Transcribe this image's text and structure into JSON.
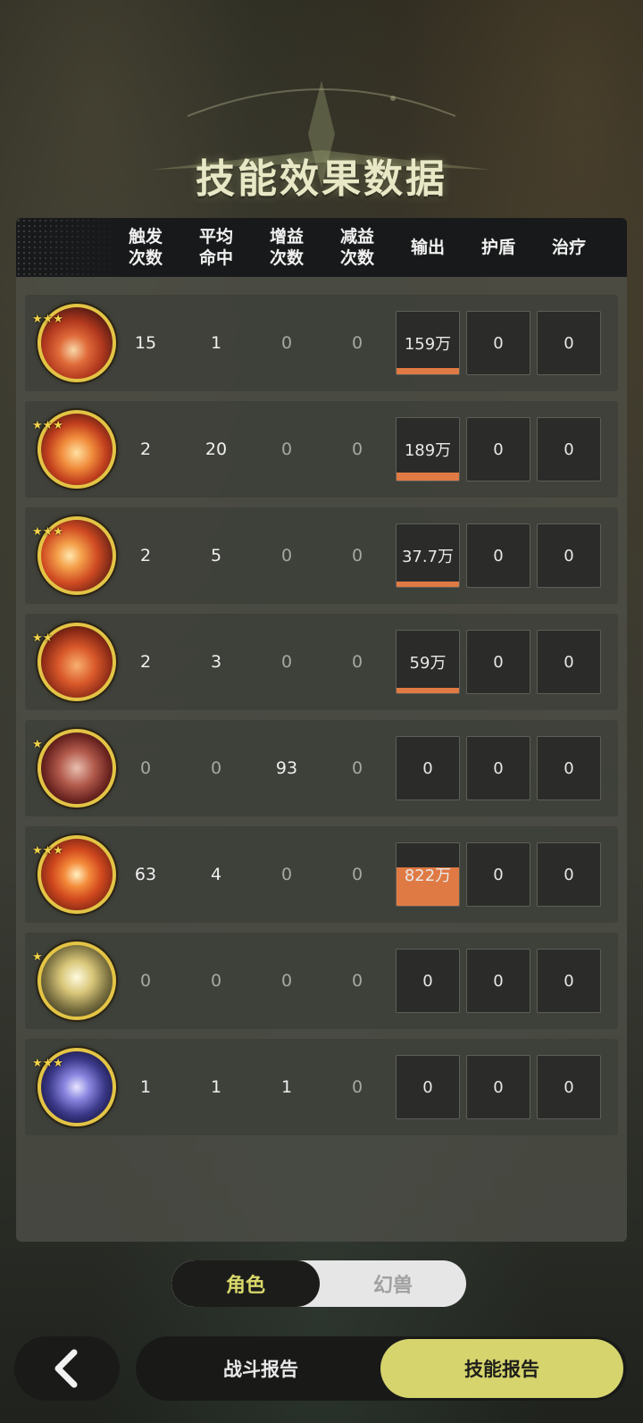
{
  "title": "技能效果数据",
  "columns": [
    {
      "line1": "触发",
      "line2": "次数"
    },
    {
      "line1": "平均",
      "line2": "命中"
    },
    {
      "line1": "增益",
      "line2": "次数"
    },
    {
      "line1": "减益",
      "line2": "次数"
    },
    {
      "line1": "输出",
      "line2": ""
    },
    {
      "line1": "护盾",
      "line2": ""
    },
    {
      "line1": "治疗",
      "line2": ""
    }
  ],
  "rows": [
    {
      "icon": "fire-meteor-icon",
      "stars": 3,
      "trigger": "15",
      "hits": "1",
      "buff": "0",
      "debuff": "0",
      "output": "159万",
      "output_fraction": 0.1,
      "shield": "0",
      "heal": "0"
    },
    {
      "icon": "fire-phoenix-icon",
      "stars": 3,
      "trigger": "2",
      "hits": "20",
      "buff": "0",
      "debuff": "0",
      "output": "189万",
      "output_fraction": 0.12,
      "shield": "0",
      "heal": "0"
    },
    {
      "icon": "fire-swirl-icon",
      "stars": 3,
      "trigger": "2",
      "hits": "5",
      "buff": "0",
      "debuff": "0",
      "output": "37.7万",
      "output_fraction": 0.03,
      "shield": "0",
      "heal": "0"
    },
    {
      "icon": "fire-wave-icon",
      "stars": 2,
      "trigger": "2",
      "hits": "3",
      "buff": "0",
      "debuff": "0",
      "output": "59万",
      "output_fraction": 0.04,
      "shield": "0",
      "heal": "0"
    },
    {
      "icon": "beast-spirit-icon",
      "stars": 1,
      "trigger": "0",
      "hits": "0",
      "buff": "93",
      "debuff": "0",
      "output": "0",
      "output_fraction": 0,
      "shield": "0",
      "heal": "0"
    },
    {
      "icon": "fire-core-icon",
      "stars": 3,
      "trigger": "63",
      "hits": "4",
      "buff": "0",
      "debuff": "0",
      "output": "822万",
      "output_fraction": 0.6,
      "shield": "0",
      "heal": "0"
    },
    {
      "icon": "golden-burst-icon",
      "stars": 1,
      "trigger": "0",
      "hits": "0",
      "buff": "0",
      "debuff": "0",
      "output": "0",
      "output_fraction": 0,
      "shield": "0",
      "heal": "0"
    },
    {
      "icon": "lightning-orb-icon",
      "stars": 3,
      "trigger": "1",
      "hits": "1",
      "buff": "1",
      "debuff": "0",
      "output": "0",
      "output_fraction": 0,
      "shield": "0",
      "heal": "0"
    }
  ],
  "toggle": {
    "left": "角色",
    "right": "幻兽",
    "selected": "角色"
  },
  "bottom": {
    "back_icon": "chevron-left-icon",
    "tab1": "战斗报告",
    "tab2": "技能报告",
    "selected": "技能报告"
  },
  "colors": {
    "accent": "#d6d46d",
    "output_fill": "#e07a44",
    "icon_ring": "#e3c445"
  }
}
